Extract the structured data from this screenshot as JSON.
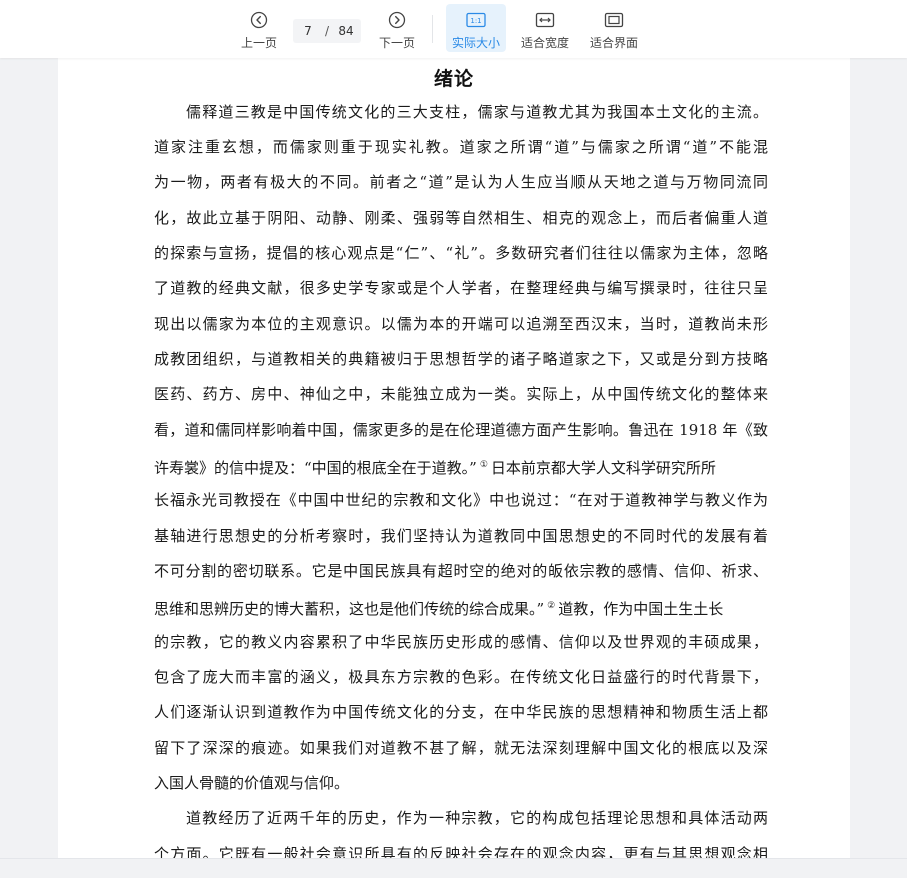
{
  "toolbar": {
    "prev_label": "上一页",
    "next_label": "下一页",
    "current_page": "7",
    "page_separator": "/",
    "total_pages": "84",
    "actual_size_label": "实际大小",
    "actual_size_icon_text": "1:1",
    "fit_width_label": "适合宽度",
    "fit_page_label": "适合界面",
    "accent_color": "#2a8ae6"
  },
  "document": {
    "title": "绪论",
    "lines": [
      "儒释道三教是中国传统文化的三大支柱，儒家与道教尤其为我国本土文化的主流。",
      "道家注重玄想，而儒家则重于现实礼教。道家之所谓“道”与儒家之所谓“道”不能混",
      "为一物，两者有极大的不同。前者之“道”是认为人生应当顺从天地之道与万物同流同",
      "化，故此立基于阴阳、动静、刚柔、强弱等自然相生、相克的观念上，而后者偏重人道",
      "的探索与宣扬，提倡的核心观点是“仁”、“礼”。多数研究者们往往以儒家为主体，忽略",
      "了道教的经典文献，很多史学专家或是个人学者，在整理经典与编写撰录时，往往只呈",
      "现出以儒家为本位的主观意识。以儒为本的开端可以追溯至西汉末，当时，道教尚未形",
      "成教团组织，与道教相关的典籍被归于思想哲学的诸子略道家之下，又或是分到方技略",
      "医药、药方、房中、神仙之中，未能独立成为一类。实际上，从中国传统文化的整体来",
      "看，道和儒同样影响着中国，儒家更多的是在伦理道德方面产生影响。鲁迅在 1918 年《致",
      "许寿裳》的信中提及：“中国的根底全在于道教。”",
      "日本前京都大学人文科学研究所所",
      "长福永光司教授在《中国中世纪的宗教和文化》中也说过：“在对于道教神学与教义作为",
      "基轴进行思想史的分析考察时，我们坚持认为道教同中国思想史的不同时代的发展有着",
      "不可分割的密切联系。它是中国民族具有超时空的绝对的皈依宗教的感情、信仰、祈求、",
      "思维和思辨历史的博大蓄积，这也是他们传统的综合成果。”",
      "道教，作为中国土生土长",
      "的宗教，它的教义内容累积了中华民族历史形成的感情、信仰以及世界观的丰硕成果，",
      "包含了庞大而丰富的涵义，极具东方宗教的色彩。在传统文化日益盛行的时代背景下，",
      "人们逐渐认识到道教作为中国传统文化的分支，在中华民族的思想精神和物质生活上都",
      "留下了深深的痕迹。如果我们对道教不甚了解，就无法深刻理解中国文化的根底以及深",
      "入国人骨髓的价值观与信仰。",
      "道教经历了近两千年的历史，作为一种宗教，它的构成包括理论思想和具体活动两",
      "个方面。它既有一般社会意识所具有的反映社会存在的观念内容，更有与其思想观念相"
    ],
    "footnote_marks": [
      "①",
      "②"
    ]
  }
}
